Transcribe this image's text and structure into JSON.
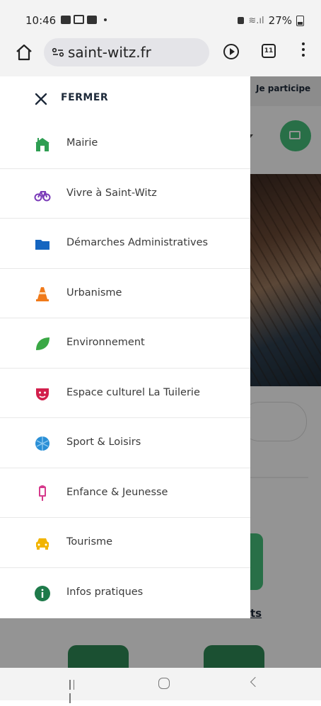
{
  "status_bar": {
    "time": "10:46",
    "battery": "27%"
  },
  "browser": {
    "url": "saint-witz.fr",
    "tab_count": "11"
  },
  "background_page": {
    "participe_label": "Je participe",
    "link_fragment": "ts"
  },
  "drawer": {
    "close_label": "FERMER",
    "items": [
      {
        "label": "Mairie",
        "icon": "town-hall-icon",
        "color": "#2e9e52"
      },
      {
        "label": "Vivre à Saint-Witz",
        "icon": "bicycle-icon",
        "color": "#7a3bb8"
      },
      {
        "label": "Démarches Administratives",
        "icon": "folder-icon",
        "color": "#1565c0"
      },
      {
        "label": "Urbanisme",
        "icon": "traffic-cone-icon",
        "color": "#f07a1a"
      },
      {
        "label": "Environnement",
        "icon": "leaf-icon",
        "color": "#3aa845"
      },
      {
        "label": "Espace culturel La Tuilerie",
        "icon": "theater-mask-icon",
        "color": "#d21f4c"
      },
      {
        "label": "Sport & Loisirs",
        "icon": "ball-icon",
        "color": "#2a8fd6"
      },
      {
        "label": "Enfance & Jeunesse",
        "icon": "ice-cream-icon",
        "color": "#d63a8c"
      },
      {
        "label": "Tourisme",
        "icon": "car-icon",
        "color": "#f2b400"
      },
      {
        "label": "Infos pratiques",
        "icon": "info-icon",
        "color": "#1e7a4a"
      }
    ]
  }
}
